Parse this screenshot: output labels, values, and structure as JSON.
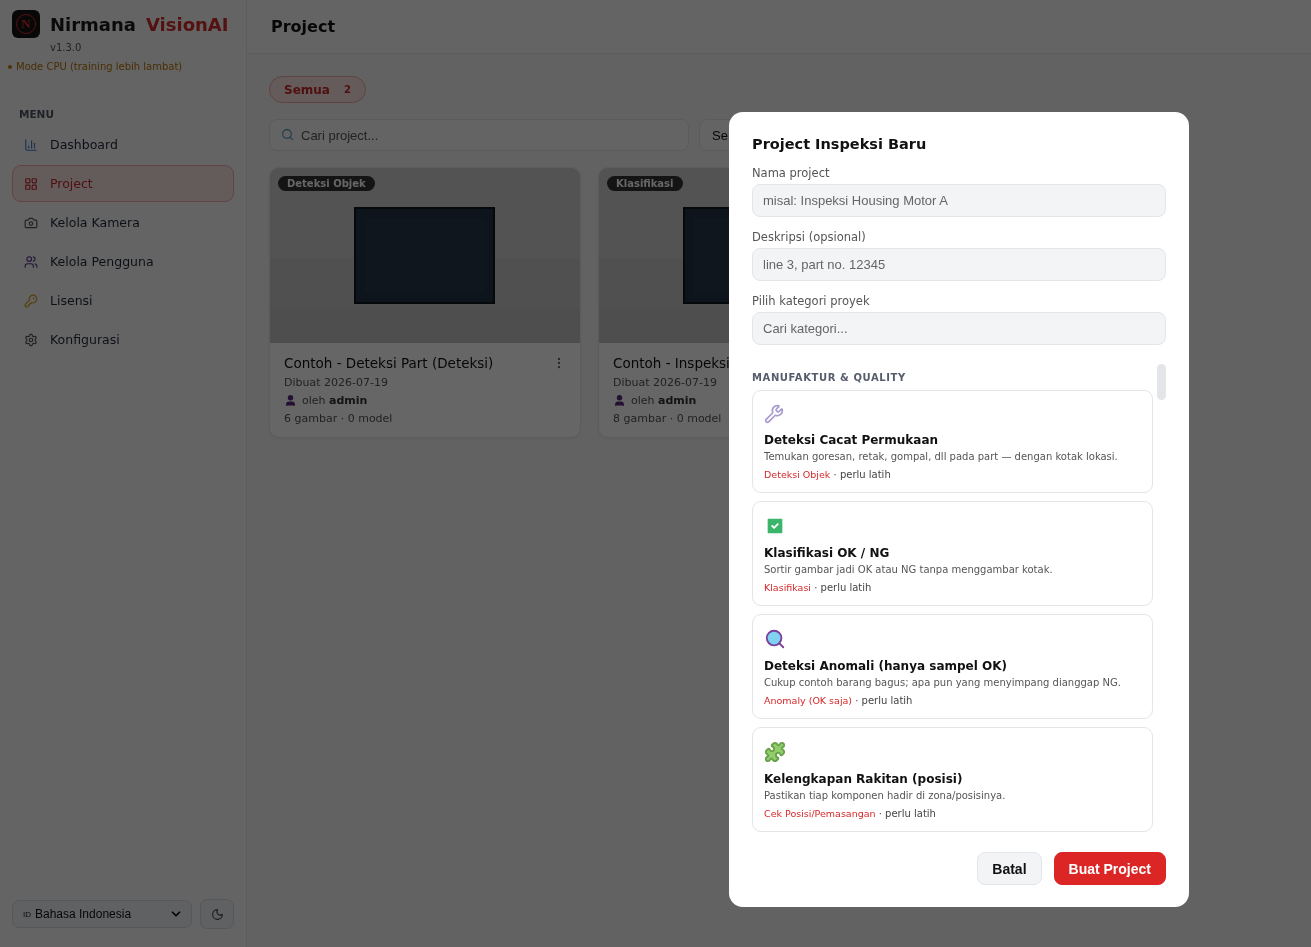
{
  "brand": {
    "logo_letter": "N",
    "name": "Nirmana",
    "accent": "VisionAI",
    "version": "v1.3.0",
    "mode": "Mode CPU (training lebih lambat)"
  },
  "menu": {
    "heading": "MENU",
    "items": [
      {
        "label": "Dashboard",
        "selected": false
      },
      {
        "label": "Project",
        "selected": true
      },
      {
        "label": "Kelola Kamera",
        "selected": false
      },
      {
        "label": "Kelola Pengguna",
        "selected": false
      },
      {
        "label": "Lisensi",
        "selected": false
      },
      {
        "label": "Konfigurasi",
        "selected": false
      }
    ]
  },
  "language": {
    "code": "ID",
    "value": "Bahasa Indonesia"
  },
  "page": {
    "title": "Project"
  },
  "filters": [
    {
      "label": "Semua",
      "count": "2",
      "selected": true
    }
  ],
  "search": {
    "placeholder": "Cari project..."
  },
  "sort_select": {
    "value": "Se"
  },
  "projects": [
    {
      "badge": "Deteksi Objek",
      "title": "Contoh - Deteksi Part (Deteksi)",
      "created": "Dibuat 2026-07-19",
      "by": "oleh",
      "owner": "admin",
      "stats": "6 gambar · 0 model",
      "has_menu": true
    },
    {
      "badge": "Klasifikasi",
      "title": "Contoh - Inspeksi",
      "created": "Dibuat 2026-07-19",
      "by": "oleh",
      "owner": "admin",
      "stats": "8 gambar · 0 model"
    }
  ],
  "dialog": {
    "title": "Project Inspeksi Baru",
    "fields": [
      {
        "label": "Nama project",
        "placeholder": "misal: Inspeksi Housing Motor A"
      },
      {
        "label": "Deskripsi (opsional)",
        "placeholder": "line 3, part no. 12345"
      },
      {
        "label": "Pilih kategori proyek",
        "placeholder": "Cari kategori..."
      }
    ],
    "group": "MANUFAKTUR & QUALITY",
    "categories": [
      {
        "title": "Deteksi Cacat Permukaan",
        "description": "Temukan goresan, retak, gompal, dll pada part — dengan kotak lokasi.",
        "tag": "Deteksi Objek",
        "note": " · perlu latih"
      },
      {
        "title": "Klasifikasi OK / NG",
        "description": "Sortir gambar jadi OK atau NG tanpa menggambar kotak.",
        "tag": "Klasifikasi",
        "note": " · perlu latih"
      },
      {
        "title": "Deteksi Anomali (hanya sampel OK)",
        "description": "Cukup contoh barang bagus; apa pun yang menyimpang dianggap NG.",
        "tag": "Anomaly (OK saja)",
        "note": " · perlu latih"
      },
      {
        "title": "Kelengkapan Rakitan (posisi)",
        "description": "Pastikan tiap komponen hadir di zona/posisinya.",
        "tag": "Cek Posisi/Pemasangan",
        "note": " · perlu latih"
      }
    ],
    "buttons": [
      {
        "label": "Batal",
        "kind": "secondary"
      },
      {
        "label": "Buat Project",
        "kind": "primary"
      }
    ]
  }
}
